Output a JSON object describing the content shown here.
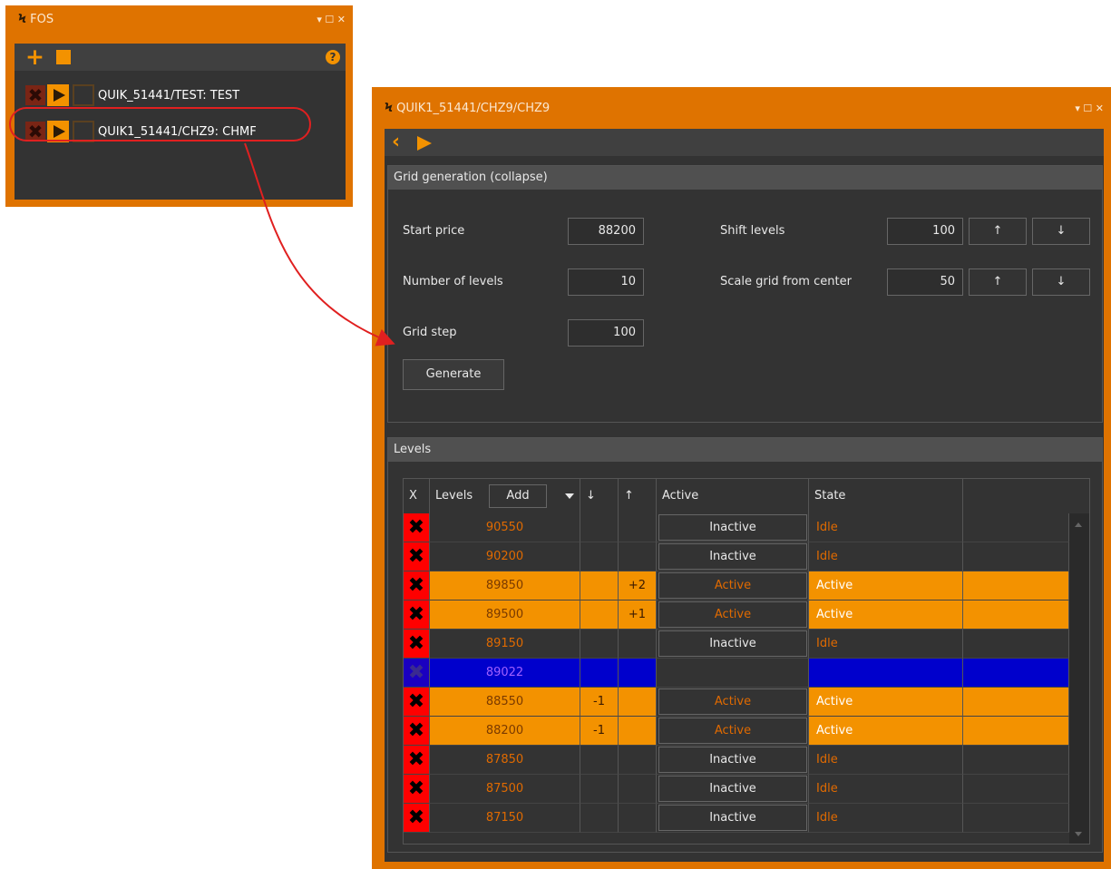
{
  "fos_window": {
    "title": "FOS",
    "title_controls": "▾ ☐ ✕",
    "toolbar": {
      "add_icon": "plus-icon",
      "stop_icon": "stop-icon",
      "help_icon": "help-icon",
      "help_glyph": "?"
    },
    "strategies": [
      {
        "label": "QUIK_51441/TEST: TEST"
      },
      {
        "label": "QUIK1_51441/CHZ9: CHMF"
      }
    ]
  },
  "main_window": {
    "title": "QUIK1_51441/CHZ9/CHZ9",
    "title_controls": "▾ ☐ ✕",
    "nav": {
      "back_icon": "chevron-left-icon",
      "forward_icon": "play-icon"
    },
    "grid_panel": {
      "header": "Grid generation (collapse)",
      "start_price_label": "Start price",
      "start_price_value": "88200",
      "number_of_levels_label": "Number of levels",
      "number_of_levels_value": "10",
      "grid_step_label": "Grid step",
      "grid_step_value": "100",
      "shift_levels_label": "Shift levels",
      "shift_levels_value": "100",
      "scale_grid_label": "Scale grid from center",
      "scale_grid_value": "50",
      "up_arrow": "↑",
      "down_arrow": "↓",
      "generate_button": "Generate"
    },
    "levels_panel": {
      "header": "Levels",
      "columns": {
        "x": "X",
        "levels": "Levels",
        "add": "Add",
        "down": "↓",
        "up": "↑",
        "active": "Active",
        "state": "State"
      },
      "rows": [
        {
          "level": "90550",
          "down": "",
          "up": "",
          "active": "Inactive",
          "state": "Idle",
          "style": "idle"
        },
        {
          "level": "90200",
          "down": "",
          "up": "",
          "active": "Inactive",
          "state": "Idle",
          "style": "idle"
        },
        {
          "level": "89850",
          "down": "",
          "up": "+2",
          "active": "Active",
          "state": "Active",
          "style": "active"
        },
        {
          "level": "89500",
          "down": "",
          "up": "+1",
          "active": "Active",
          "state": "Active",
          "style": "active"
        },
        {
          "level": "89150",
          "down": "",
          "up": "",
          "active": "Inactive",
          "state": "Idle",
          "style": "idle"
        },
        {
          "level": "89022",
          "down": "",
          "up": "",
          "active": "",
          "state": "",
          "style": "current"
        },
        {
          "level": "88550",
          "down": "-1",
          "up": "",
          "active": "Active",
          "state": "Active",
          "style": "active"
        },
        {
          "level": "88200",
          "down": "-1",
          "up": "",
          "active": "Active",
          "state": "Active",
          "style": "active"
        },
        {
          "level": "87850",
          "down": "",
          "up": "",
          "active": "Inactive",
          "state": "Idle",
          "style": "idle"
        },
        {
          "level": "87500",
          "down": "",
          "up": "",
          "active": "Inactive",
          "state": "Idle",
          "style": "idle"
        },
        {
          "level": "87150",
          "down": "",
          "up": "",
          "active": "Inactive",
          "state": "Idle",
          "style": "idle"
        }
      ]
    }
  },
  "colors": {
    "window_frame": "#df7300",
    "body_bg": "#333333",
    "accent_orange": "#f39200",
    "level_text": "#e06a00",
    "delete_red": "#ff0000",
    "current_blue": "#0000cc",
    "annotation_red": "#e02020"
  }
}
